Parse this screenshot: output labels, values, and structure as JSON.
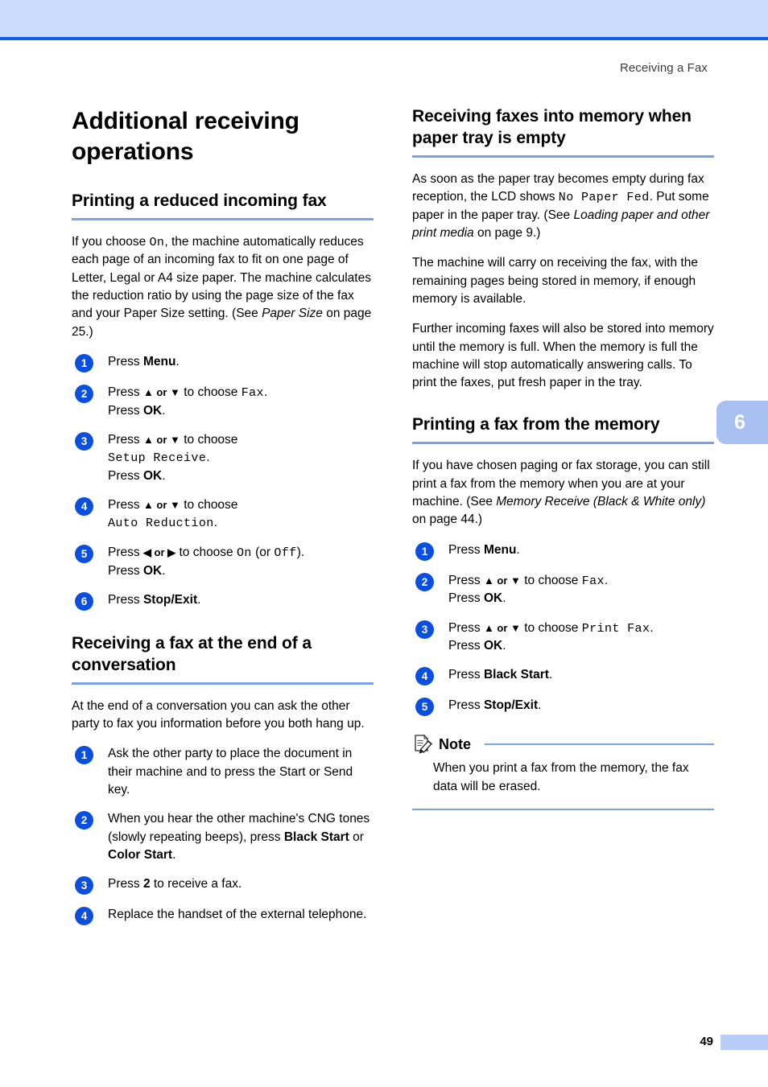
{
  "page": {
    "running_head": "Receiving a Fax",
    "chapter_tab": "6",
    "page_number": "49"
  },
  "colors": {
    "header_band": "#ccdcfb",
    "header_rule": "#0d5bef",
    "heading_rule": "#7ba0ea",
    "step_circle": "#0a4fe0",
    "chapter_tab": "#a8c0f2",
    "footer_block": "#b8cef8"
  },
  "left_column": {
    "chapter_title": "Additional receiving operations",
    "section1": {
      "heading": "Printing a reduced incoming fax",
      "intro_parts": {
        "p1a": "If you choose ",
        "p1_lcd": "On",
        "p1b": ", the machine automatically reduces each page of an incoming fax to fit on one page of Letter, Legal or A4 size paper. The machine calculates the reduction ratio by using the page size of the fax and your Paper Size setting. (See ",
        "p1_italic": "Paper Size",
        "p1c": " on page 25.)"
      },
      "steps": [
        {
          "num": "1",
          "line1_pre": "Press ",
          "line1_bold": "Menu",
          "line1_post": "."
        },
        {
          "num": "2",
          "line1_pre": "Press ",
          "line1_arrows": "▲ or ▼",
          "line1_mid": " to choose ",
          "line1_lcd": "Fax",
          "line1_post": ".",
          "line2_pre": "Press ",
          "line2_bold": "OK",
          "line2_post": "."
        },
        {
          "num": "3",
          "line1_pre": "Press ",
          "line1_arrows": "▲ or ▼",
          "line1_mid": " to choose",
          "line_lcd_break": "Setup Receive",
          "line_lcd_post": ".",
          "line2_pre": "Press ",
          "line2_bold": "OK",
          "line2_post": "."
        },
        {
          "num": "4",
          "line1_pre": "Press ",
          "line1_arrows": "▲ or ▼",
          "line1_mid": " to choose",
          "line_lcd_break": "Auto Reduction",
          "line_lcd_post": "."
        },
        {
          "num": "5",
          "line1_pre": "Press ",
          "line1_arrows": "◀ or ▶",
          "line1_mid": " to choose ",
          "line1_lcd": "On",
          "line1_mid2": " (or ",
          "line1_lcd2": "Off",
          "line1_post": ").",
          "line2_pre": "Press ",
          "line2_bold": "OK",
          "line2_post": "."
        },
        {
          "num": "6",
          "line1_pre": "Press ",
          "line1_bold": "Stop/Exit",
          "line1_post": "."
        }
      ]
    },
    "section2": {
      "heading": "Receiving a fax at the end of a conversation",
      "intro": "At the end of a conversation you can ask the other party to fax you information before you both hang up.",
      "steps": [
        {
          "num": "1",
          "text": "Ask the other party to place the document in their machine and to press the Start or Send key."
        },
        {
          "num": "2",
          "pre": "When you hear the other machine's CNG tones (slowly repeating beeps), press ",
          "bold1": "Black Start",
          "mid": " or ",
          "bold2": "Color Start",
          "post": "."
        },
        {
          "num": "3",
          "pre": "Press ",
          "bold1": "2",
          "post": " to receive a fax."
        },
        {
          "num": "4",
          "text": "Replace the handset of the external telephone."
        }
      ]
    }
  },
  "right_column": {
    "section1": {
      "heading": "Receiving faxes into memory when paper tray is empty",
      "p1a": "As soon as the paper tray becomes empty during fax reception, the LCD shows ",
      "p1_lcd": "No Paper Fed",
      "p1b": ". Put some paper in the paper tray. (See ",
      "p1_italic": "Loading paper and other print media",
      "p1c": " on page 9.)",
      "p2": "The machine will carry on receiving the fax, with the remaining pages being stored in memory, if enough memory is available.",
      "p3": "Further incoming faxes will also be stored into memory until the memory is full. When the memory is full the machine will stop automatically answering calls. To print the faxes, put fresh paper in the tray."
    },
    "section2": {
      "heading": "Printing a fax from the memory",
      "p1a": "If you have chosen paging or fax storage, you can still print a fax from the memory when you are at your machine. (See ",
      "p1_italic": "Memory Receive (Black & White only)",
      "p1b": " on page 44.)",
      "steps": [
        {
          "num": "1",
          "line1_pre": "Press ",
          "line1_bold": "Menu",
          "line1_post": "."
        },
        {
          "num": "2",
          "line1_pre": "Press ",
          "line1_arrows": "▲ or ▼",
          "line1_mid": " to choose ",
          "line1_lcd": "Fax",
          "line1_post": ".",
          "line2_pre": "Press ",
          "line2_bold": "OK",
          "line2_post": "."
        },
        {
          "num": "3",
          "line1_pre": "Press ",
          "line1_arrows": "▲ or ▼",
          "line1_mid": " to choose ",
          "line1_lcd": "Print Fax",
          "line1_post": ".",
          "line2_pre": "Press ",
          "line2_bold": "OK",
          "line2_post": "."
        },
        {
          "num": "4",
          "line1_pre": "Press ",
          "line1_bold": "Black Start",
          "line1_post": "."
        },
        {
          "num": "5",
          "line1_pre": "Press ",
          "line1_bold": "Stop/Exit",
          "line1_post": "."
        }
      ],
      "note": {
        "label": "Note",
        "body": "When you print a fax from the memory, the fax data will be erased."
      }
    }
  }
}
